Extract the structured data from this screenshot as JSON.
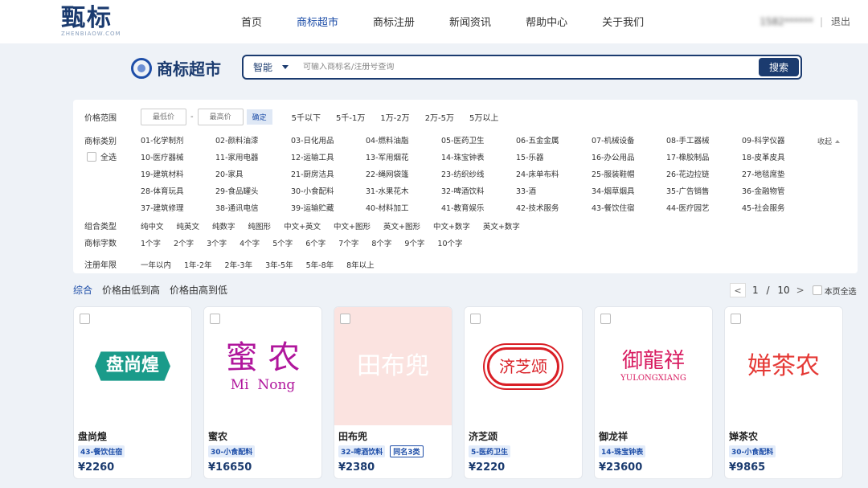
{
  "header": {
    "logo_main": "甄标",
    "logo_sub": "ZHENBIAOW.COM",
    "nav": [
      "首页",
      "商标超市",
      "商标注册",
      "新闻资讯",
      "帮助中心",
      "关于我们"
    ],
    "nav_active_index": 1,
    "user": "1582******",
    "logout": "退出"
  },
  "search": {
    "title": "商标超市",
    "mode": "智能",
    "placeholder": "可输入商标名/注册号查询",
    "button": "搜索"
  },
  "filter": {
    "price": {
      "label": "价格范围",
      "min_placeholder": "最低价",
      "max_placeholder": "最高价",
      "confirm": "确定",
      "options": [
        "5千以下",
        "5千-1万",
        "1万-2万",
        "2万-5万",
        "5万以上"
      ]
    },
    "category": {
      "label": "商标类别",
      "select_all": "全选",
      "collapse": "收起",
      "items": [
        "01-化学制剂",
        "02-颜料油漆",
        "03-日化用品",
        "04-燃料油脂",
        "05-医药卫生",
        "06-五金金属",
        "07-机械设备",
        "08-手工器械",
        "09-科学仪器",
        "10-医疗器械",
        "11-家用电器",
        "12-运输工具",
        "13-军用烟花",
        "14-珠宝钟表",
        "15-乐器",
        "16-办公用品",
        "17-橡胶制品",
        "18-皮革皮具",
        "19-建筑材料",
        "20-家具",
        "21-厨房洁具",
        "22-绳网袋篷",
        "23-纺织纱线",
        "24-床单布料",
        "25-服装鞋帽",
        "26-花边拉链",
        "27-地毯席垫",
        "28-体育玩具",
        "29-食品罐头",
        "30-小食配料",
        "31-水果花木",
        "32-啤酒饮料",
        "33-酒",
        "34-烟草烟具",
        "35-广告销售",
        "36-金融物管",
        "37-建筑修理",
        "38-通讯电信",
        "39-运输贮藏",
        "40-材料加工",
        "41-教育娱乐",
        "42-技术服务",
        "43-餐饮住宿",
        "44-医疗园艺",
        "45-社会服务"
      ]
    },
    "combo": {
      "label": "组合类型",
      "options": [
        "纯中文",
        "纯英文",
        "纯数字",
        "纯图形",
        "中文+英文",
        "中文+图形",
        "英文+图形",
        "中文+数字",
        "英文+数字"
      ]
    },
    "chars": {
      "label": "商标字数",
      "options": [
        "1个字",
        "2个字",
        "3个字",
        "4个字",
        "5个字",
        "6个字",
        "7个字",
        "8个字",
        "9个字",
        "10个字"
      ]
    },
    "years": {
      "label": "注册年限",
      "options": [
        "一年以内",
        "1年-2年",
        "2年-3年",
        "3年-5年",
        "5年-8年",
        "8年以上"
      ]
    }
  },
  "sort": {
    "options": [
      "综合",
      "价格由低到高",
      "价格由高到低"
    ],
    "active_index": 0
  },
  "pager": {
    "prev": "<",
    "current": "1",
    "slash": "/",
    "total": "10",
    "next": ">",
    "select_page": "本页全选"
  },
  "cards": [
    {
      "name": "盘尚煌",
      "logo_text": "盘尚煌",
      "logo_sub": "",
      "tag": "43-餐饮住宿",
      "extra_tag": "",
      "price": "¥2260",
      "logo_color": "#1a9b8a"
    },
    {
      "name": "蜜农",
      "logo_text": "蜜 农",
      "logo_sub": "Mi  Nong",
      "tag": "30-小食配料",
      "extra_tag": "",
      "price": "¥16650",
      "logo_color": "#b0169c"
    },
    {
      "name": "田布兜",
      "logo_text": "田布兜",
      "logo_sub": "",
      "tag": "32-啤酒饮料",
      "extra_tag": "同名3类",
      "price": "¥2380",
      "logo_color": "#e8776d"
    },
    {
      "name": "济芝颂",
      "logo_text": "济芝颂",
      "logo_sub": "",
      "tag": "5-医药卫生",
      "extra_tag": "",
      "price": "¥2220",
      "logo_color": "#d91f26"
    },
    {
      "name": "御龙祥",
      "logo_text": "御龍祥",
      "logo_sub": "YULONGXIANG",
      "tag": "14-珠宝钟表",
      "extra_tag": "",
      "price": "¥23600",
      "logo_color": "#d81b60"
    },
    {
      "name": "婵茶农",
      "logo_text": "婵茶农",
      "logo_sub": "",
      "tag": "30-小食配料",
      "extra_tag": "",
      "price": "¥9865",
      "logo_color": "#e53935"
    }
  ]
}
